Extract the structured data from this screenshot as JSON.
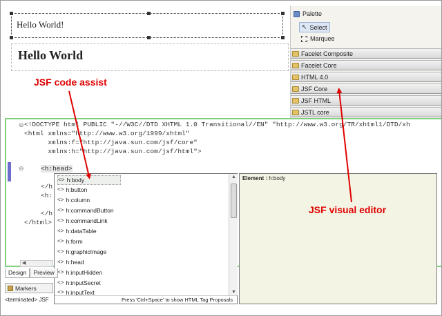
{
  "design": {
    "box_text": "Hello World!",
    "heading_text": "Hello World"
  },
  "palette": {
    "title": "Palette",
    "tools": [
      "Select",
      "Marquee"
    ],
    "drawers": [
      "Facelet Composite",
      "Facelet Core",
      "HTML 4.0",
      "JSF Core",
      "JSF HTML",
      "JSTL core"
    ]
  },
  "source": {
    "lines": [
      "<!DOCTYPE html PUBLIC \"-//W3C//DTD XHTML 1.0 Transitional//EN\" \"http://www.w3.org/TR/xhtml1/DTD/xh",
      "<html xmlns=\"http://www.w3.org/1999/xhtml\"",
      "      xmlns:f=\"http://java.sun.com/jsf/core\"",
      "      xmlns:h=\"http://java.sun.com/jsf/html\">",
      "<h:head>",
      "</h",
      "<h:",
      "</h",
      "</html>"
    ]
  },
  "assist": {
    "items": [
      "h:body",
      "h:button",
      "h:column",
      "h:commandButton",
      "h:commandLink",
      "h:dataTable",
      "h:form",
      "h:graphicImage",
      "h:head",
      "h:inputHidden",
      "h:inputSecret",
      "h:inputText"
    ],
    "icon_glyph": "<>",
    "status": "Press 'Ctrl+Space' to show HTML Tag Proposals"
  },
  "doc": {
    "label": "Element :",
    "value": "h:body"
  },
  "editor_tabs": [
    "Design",
    "Preview"
  ],
  "bottom": {
    "tab": "Markers",
    "terminated": "<terminated> JSF"
  },
  "annotations": {
    "code_assist": "JSF code assist",
    "visual_editor": "JSF visual editor"
  },
  "colors": {
    "annotation": "#e00000",
    "source_border": "#7fd07f",
    "doc_bg": "#f4f4e4"
  }
}
